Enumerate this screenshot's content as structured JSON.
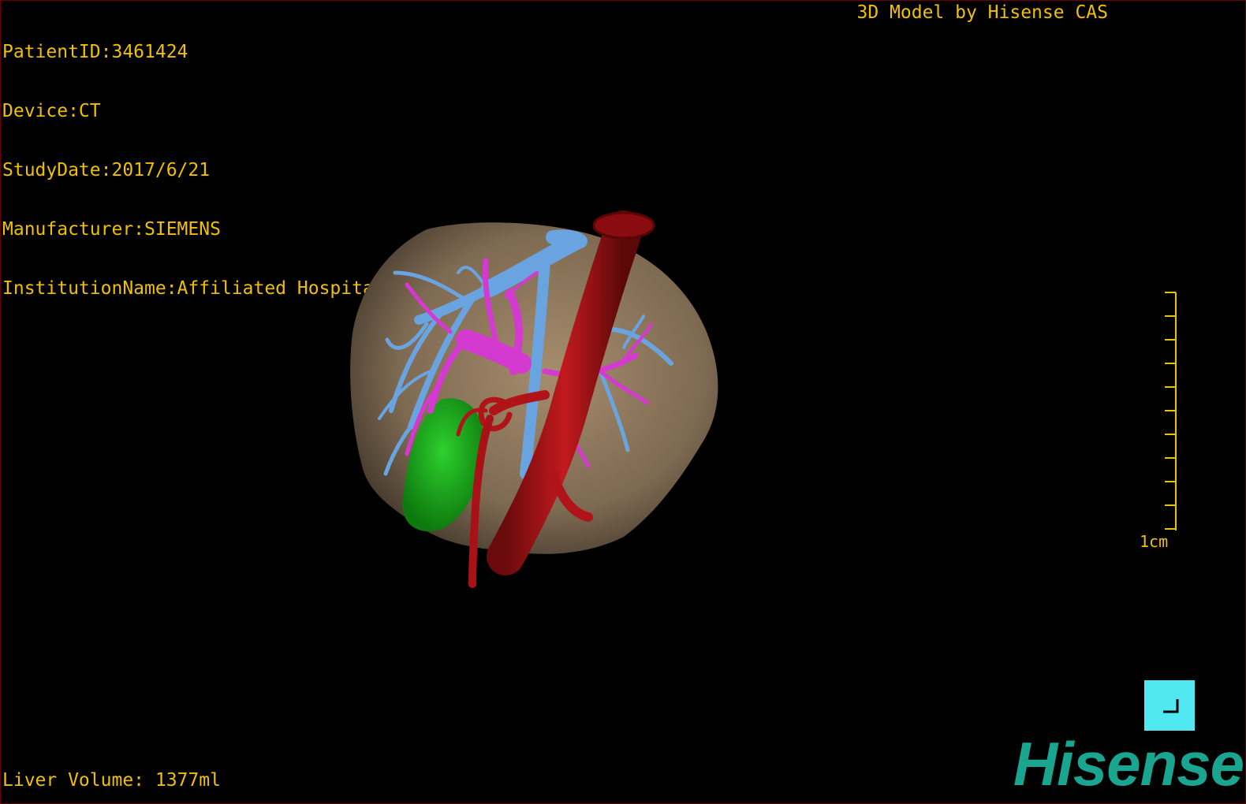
{
  "viewer": {
    "patient_id": "PatientID:3461424",
    "device": "Device:CT",
    "study_date": "StudyDate:2017/6/21",
    "manufacturer": "Manufacturer:SIEMENS",
    "institution": "InstitutionName:Affiliated Hospital Qingdao University-C",
    "model_credit": "3D Model by Hisense CAS",
    "liver_volume": "Liver Volume: 1377ml"
  },
  "scale": {
    "label": "1cm"
  },
  "logo": {
    "text": "Hisense"
  },
  "colors": {
    "overlay_text": "#f0c000",
    "liver": "#8a7458",
    "hepatic_vein": "#6aa4e0",
    "portal_vein": "#d43ad0",
    "artery": "#b01418",
    "gallbladder": "#1ca81c",
    "logo": "#1aa591",
    "corner_button": "#52e8f2"
  },
  "icons": {
    "corner_button": "corner-bracket-icon"
  }
}
